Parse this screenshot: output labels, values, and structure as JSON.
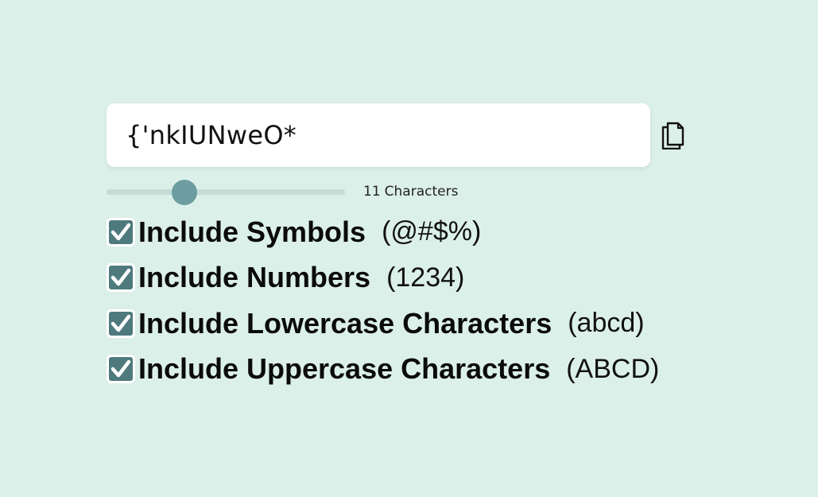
{
  "password": {
    "value": "{'nkIUNweO*"
  },
  "copy": {
    "icon": "copy-icon"
  },
  "length": {
    "value": 11,
    "min": 4,
    "max": 32,
    "count": "11",
    "unit_label": "Characters"
  },
  "options": [
    {
      "label": "Include Symbols",
      "example": "(@#$%)",
      "checked": true
    },
    {
      "label": "Include Numbers",
      "example": "(1234)",
      "checked": true
    },
    {
      "label": "Include Lowercase Characters",
      "example": "(abcd)",
      "checked": true
    },
    {
      "label": "Include Uppercase Characters",
      "example": "(ABCD)",
      "checked": true
    }
  ],
  "colors": {
    "background": "#dcf0ea",
    "checkbox": "#4e7a7d",
    "slider_thumb": "#6c9ea1",
    "slider_track": "#c6dcd7"
  }
}
